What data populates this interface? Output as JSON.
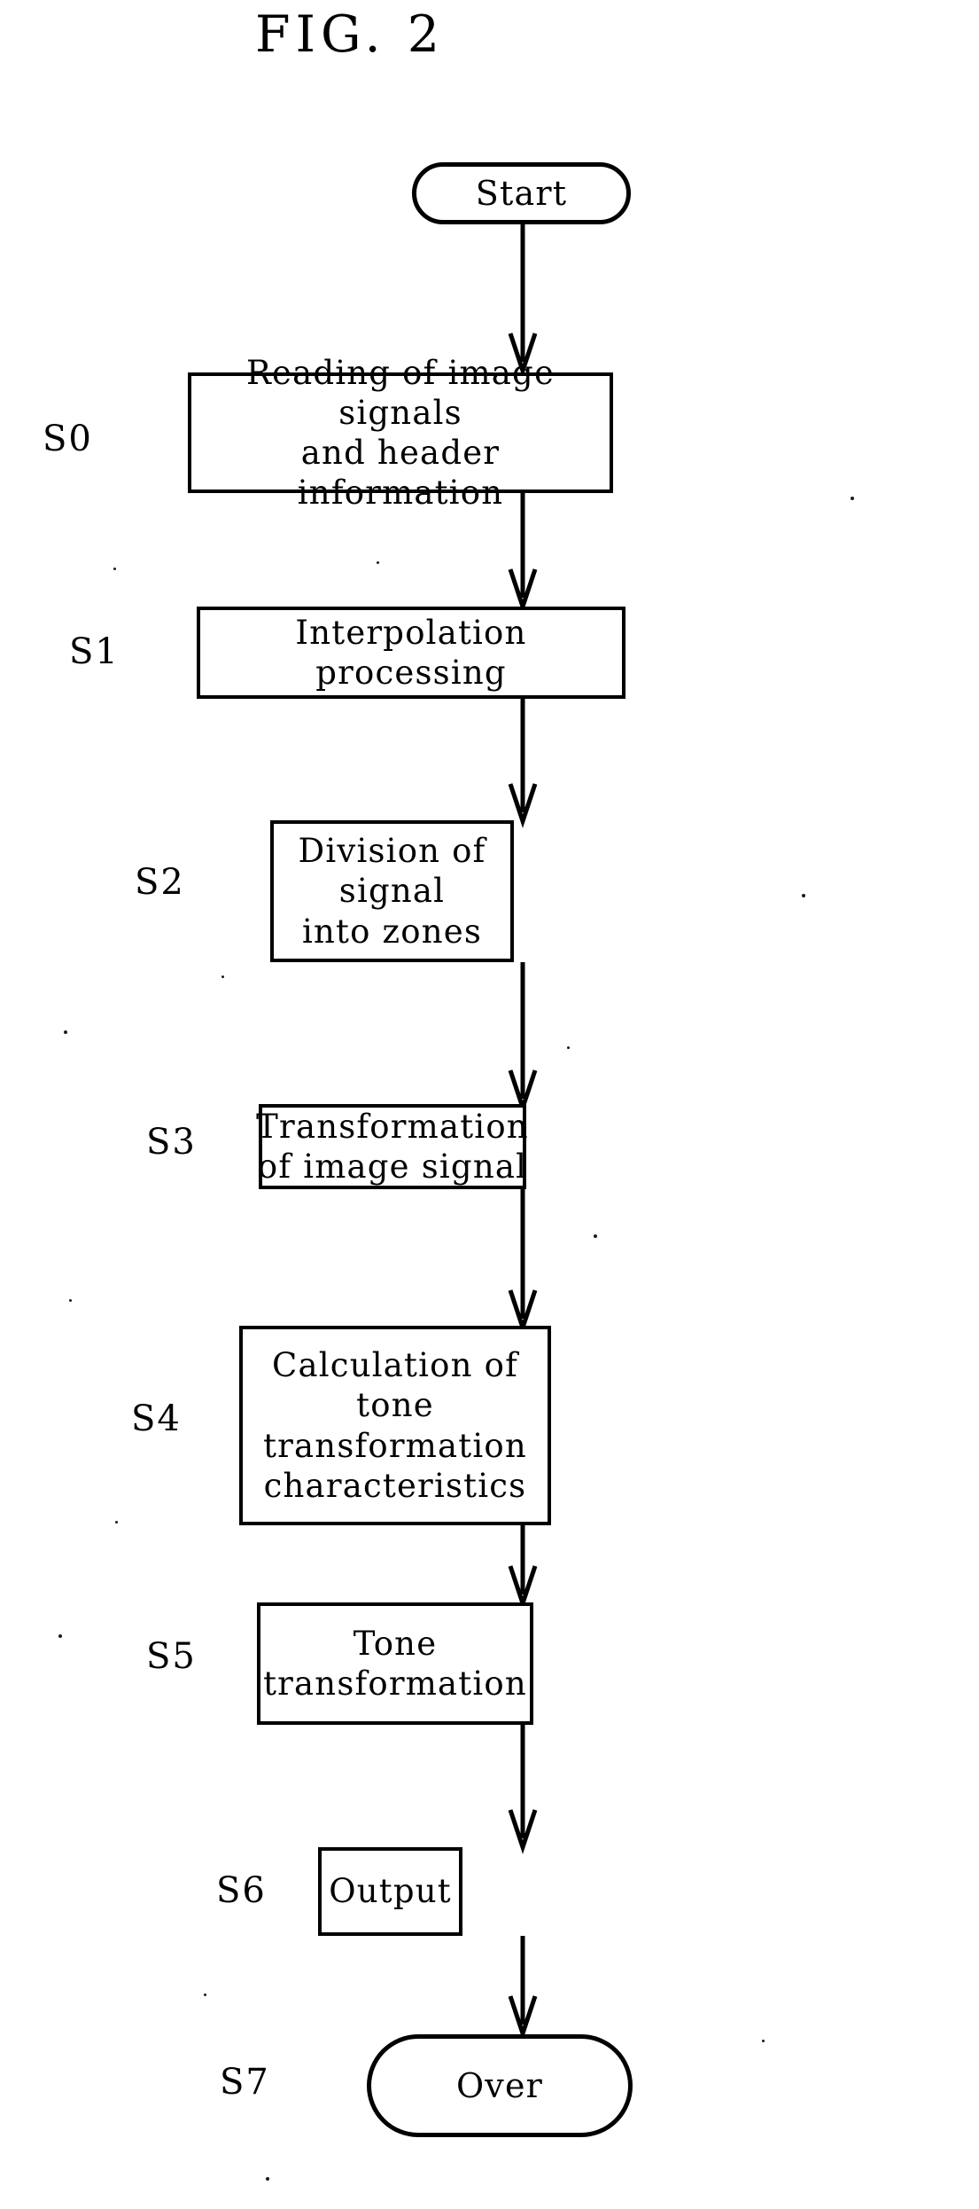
{
  "figure": {
    "title": "FIG. 2",
    "ink_color": "#000000",
    "background_color": "#ffffff"
  },
  "nodes": [
    {
      "id": "start",
      "shape": "terminal",
      "step": "",
      "text": "Start"
    },
    {
      "id": "s0",
      "shape": "process",
      "step": "S0",
      "text": "Reading of image signals\nand header information"
    },
    {
      "id": "s1",
      "shape": "process",
      "step": "S1",
      "text": "Interpolation processing"
    },
    {
      "id": "s2",
      "shape": "process",
      "step": "S2",
      "text": "Division of signal\ninto zones"
    },
    {
      "id": "s3",
      "shape": "process",
      "step": "S3",
      "text": "Transformation\nof image signal"
    },
    {
      "id": "s4",
      "shape": "process",
      "step": "S4",
      "text": "Calculation of\ntone transformation\ncharacteristics"
    },
    {
      "id": "s5",
      "shape": "process",
      "step": "S5",
      "text": "Tone\ntransformation"
    },
    {
      "id": "s6",
      "shape": "process",
      "step": "S6",
      "text": "Output"
    },
    {
      "id": "s7",
      "shape": "terminal",
      "step": "S7",
      "text": "Over"
    }
  ],
  "connectors": [
    {
      "from": "start",
      "to": "s0"
    },
    {
      "from": "s0",
      "to": "s1"
    },
    {
      "from": "s1",
      "to": "s2"
    },
    {
      "from": "s2",
      "to": "s3"
    },
    {
      "from": "s3",
      "to": "s4"
    },
    {
      "from": "s4",
      "to": "s5"
    },
    {
      "from": "s5",
      "to": "s6"
    },
    {
      "from": "s6",
      "to": "s7"
    }
  ]
}
